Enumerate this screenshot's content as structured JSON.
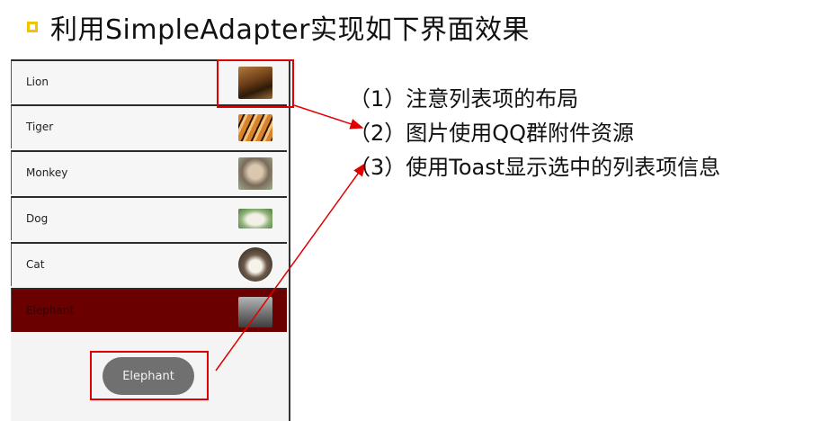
{
  "title": "利用SimpleAdapter实现如下界面效果",
  "list": {
    "items": [
      {
        "label": "Lion",
        "thumb_icon": "lion-thumbnail-icon"
      },
      {
        "label": "Tiger",
        "thumb_icon": "tiger-thumbnail-icon"
      },
      {
        "label": "Monkey",
        "thumb_icon": "monkey-thumbnail-icon"
      },
      {
        "label": "Dog",
        "thumb_icon": "dog-thumbnail-icon"
      },
      {
        "label": "Cat",
        "thumb_icon": "cat-thumbnail-icon"
      },
      {
        "label": "Elephant",
        "thumb_icon": "elephant-thumbnail-icon"
      }
    ],
    "selected_label": "Elephant",
    "selected_color": "#6b0000"
  },
  "toast": {
    "text": "Elephant"
  },
  "notes": [
    "（1）注意列表项的布局",
    "（2）图片使用QQ群附件资源",
    "（3）使用Toast显示选中的列表项信息"
  ],
  "colors": {
    "bullet": "#f2c400",
    "annotation": "#e00000"
  }
}
